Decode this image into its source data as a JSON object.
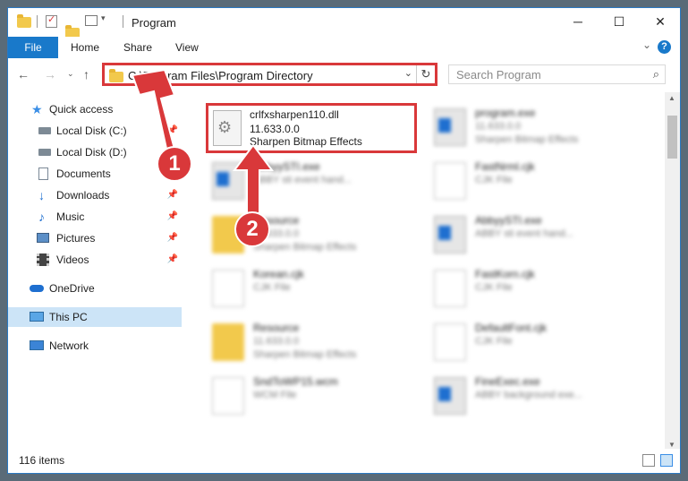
{
  "window": {
    "title": "Program",
    "controls": {
      "minimize": "─",
      "maximize": "☐",
      "close": "✕"
    }
  },
  "ribbon": {
    "tabs": [
      "File",
      "Home",
      "Share",
      "View"
    ],
    "help": "?"
  },
  "navigation": {
    "address": "C:\\Program Files\\Program Directory",
    "search_placeholder": "Search Program"
  },
  "sidebar": {
    "items": [
      {
        "label": "Quick access",
        "icon": "star-icon",
        "pinned": false
      },
      {
        "label": "Local Disk (C:)",
        "icon": "drive-icon",
        "pinned": true
      },
      {
        "label": "Local Disk (D:)",
        "icon": "drive-icon",
        "pinned": false
      },
      {
        "label": "Documents",
        "icon": "documents-icon",
        "pinned": true
      },
      {
        "label": "Downloads",
        "icon": "download-icon",
        "pinned": true
      },
      {
        "label": "Music",
        "icon": "music-icon",
        "pinned": true
      },
      {
        "label": "Pictures",
        "icon": "pictures-icon",
        "pinned": true
      },
      {
        "label": "Videos",
        "icon": "video-icon",
        "pinned": true
      },
      {
        "label": "OneDrive",
        "icon": "cloud-icon",
        "pinned": false
      },
      {
        "label": "This PC",
        "icon": "computer-icon",
        "pinned": false
      },
      {
        "label": "Network",
        "icon": "network-icon",
        "pinned": false
      }
    ],
    "pin_glyph": "📌"
  },
  "files": {
    "highlighted": {
      "name": "crlfxsharpen110.dll",
      "version": "11.633.0.0",
      "description": "Sharpen Bitmap Effects",
      "icon": "dll-gear-icon"
    },
    "items": [
      {
        "name": "program.exe",
        "line2": "11.633.0.0",
        "line3": "Sharpen Bitmap Effects",
        "icon": "exe-icon"
      },
      {
        "name": "AbbyySTI.exe",
        "line2": "ABBY sti event hand...",
        "line3": "",
        "icon": "window-icon"
      },
      {
        "name": "FastNrml.cjk",
        "line2": "CJK File",
        "line3": "",
        "icon": "file-icon"
      },
      {
        "name": "Resource",
        "line2": "11.633.0.0",
        "line3": "Sharpen Bitmap Effects",
        "icon": "folder-icon"
      },
      {
        "name": "AbbyySTI.exe",
        "line2": "ABBY sti event hand...",
        "line3": "",
        "icon": "window-icon"
      },
      {
        "name": "Korean.cjk",
        "line2": "CJK File",
        "line3": "",
        "icon": "file-icon"
      },
      {
        "name": "FastKorn.cjk",
        "line2": "CJK File",
        "line3": "",
        "icon": "file-icon"
      },
      {
        "name": "Resource",
        "line2": "11.633.0.0",
        "line3": "Sharpen Bitmap Effects",
        "icon": "folder-icon"
      },
      {
        "name": "DefaultFont.cjk",
        "line2": "CJK File",
        "line3": "",
        "icon": "file-icon"
      },
      {
        "name": "SndToWP15.wcm",
        "line2": "WCM File",
        "line3": "",
        "icon": "file-icon"
      },
      {
        "name": "FineExec.exe",
        "line2": "ABBY background exe...",
        "line3": "",
        "icon": "window-icon"
      }
    ]
  },
  "status": {
    "count": "116 items"
  },
  "annotations": {
    "step1": "1",
    "step2": "2",
    "color": "#d9383a"
  }
}
